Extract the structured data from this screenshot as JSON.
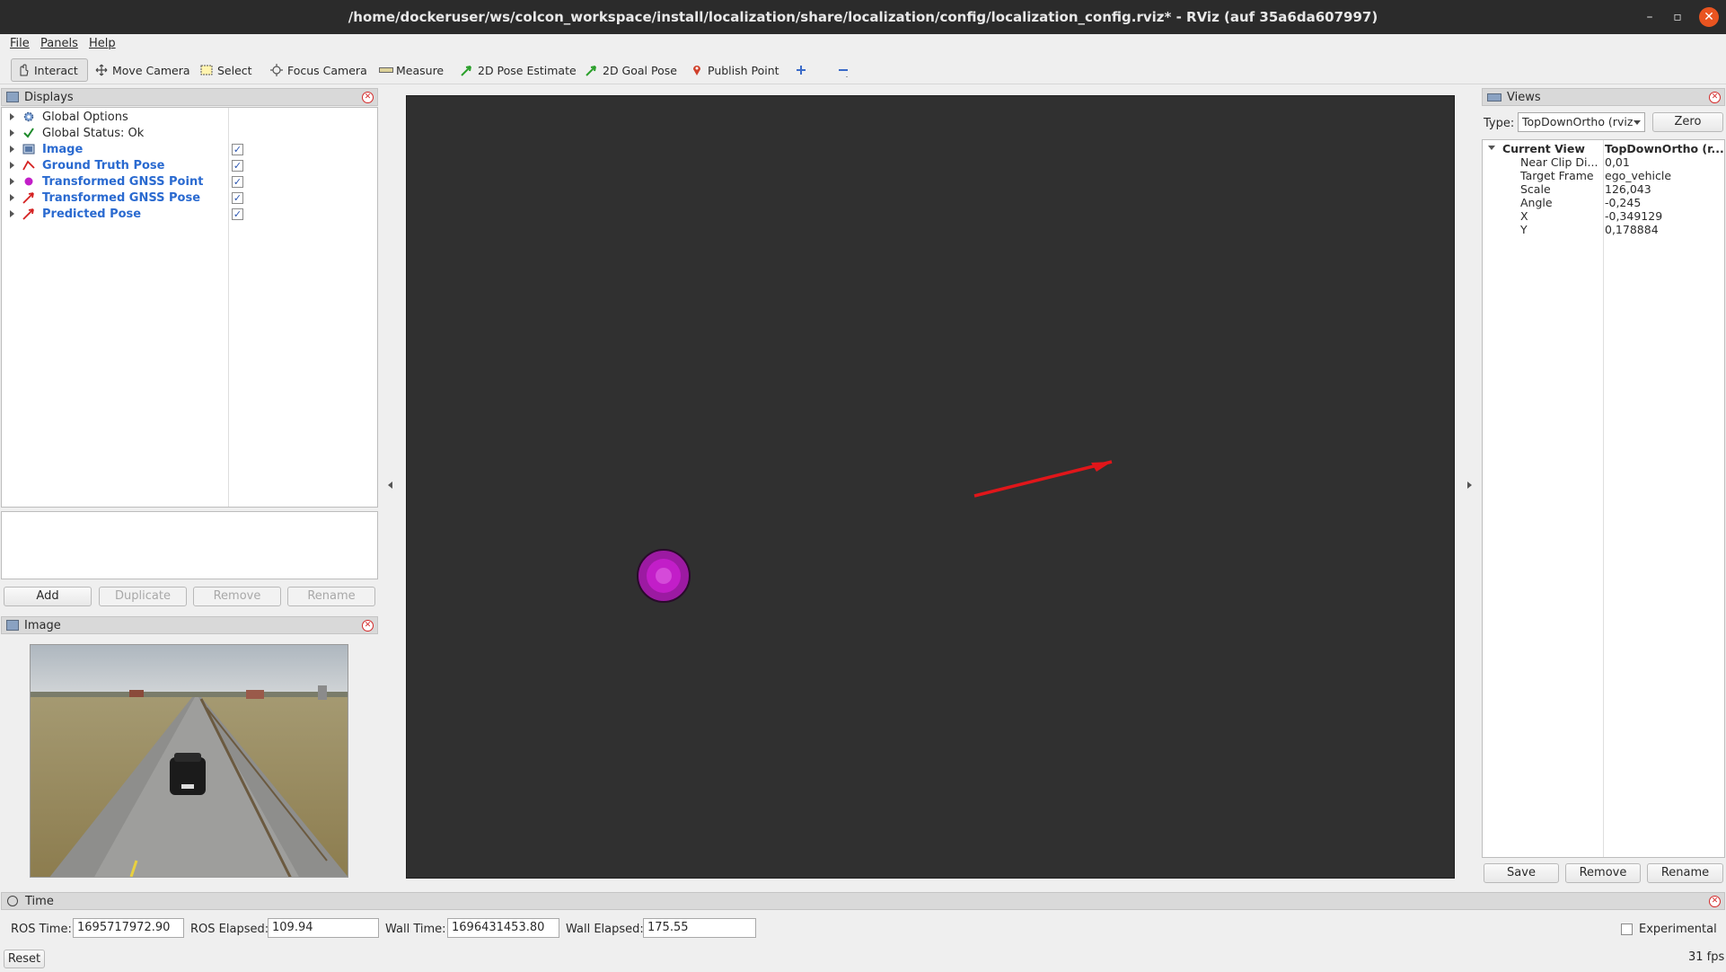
{
  "window": {
    "title": "/home/dockeruser/ws/colcon_workspace/install/localization/share/localization/config/localization_config.rviz* - RViz (auf 35a6da607997)"
  },
  "menu": [
    "File",
    "Panels",
    "Help"
  ],
  "toolbar": {
    "interact": "Interact",
    "move_camera": "Move Camera",
    "select": "Select",
    "focus_camera": "Focus Camera",
    "measure": "Measure",
    "pose_estimate": "2D Pose Estimate",
    "goal_pose": "2D Goal Pose",
    "publish_point": "Publish Point"
  },
  "displays": {
    "title": "Displays",
    "items": [
      {
        "label": "Global Options"
      },
      {
        "label": "Global Status: Ok"
      },
      {
        "label": "Image",
        "checked": true
      },
      {
        "label": "Ground Truth Pose",
        "checked": true
      },
      {
        "label": "Transformed GNSS Point",
        "checked": true
      },
      {
        "label": "Transformed GNSS Pose",
        "checked": true
      },
      {
        "label": "Predicted Pose",
        "checked": true
      }
    ],
    "buttons": {
      "add": "Add",
      "duplicate": "Duplicate",
      "remove": "Remove",
      "rename": "Rename"
    },
    "check_mark": "✓"
  },
  "image_panel": {
    "title": "Image"
  },
  "views": {
    "title": "Views",
    "type_label": "Type:",
    "type_value": "TopDownOrtho (rviz",
    "zero": "Zero",
    "current_view": {
      "label": "Current View",
      "value": "TopDownOrtho (r..."
    },
    "props": [
      {
        "key": "Near Clip Di...",
        "value": "0,01"
      },
      {
        "key": "Target Frame",
        "value": "ego_vehicle"
      },
      {
        "key": "Scale",
        "value": "126,043"
      },
      {
        "key": "Angle",
        "value": "-0,245"
      },
      {
        "key": "X",
        "value": "-0,349129"
      },
      {
        "key": "Y",
        "value": "0,178884"
      }
    ],
    "buttons": {
      "save": "Save",
      "remove": "Remove",
      "rename": "Rename"
    }
  },
  "time": {
    "title": "Time",
    "ros_time_label": "ROS Time:",
    "ros_time": "1695717972.90",
    "ros_elapsed_label": "ROS Elapsed:",
    "ros_elapsed": "109.94",
    "wall_time_label": "Wall Time:",
    "wall_time": "1696431453.80",
    "wall_elapsed_label": "Wall Elapsed:",
    "wall_elapsed": "175.55",
    "experimental": "Experimental",
    "reset": "Reset",
    "fps": "31 fps"
  },
  "colors": {
    "viewport_bg": "#303030",
    "arrow": "#e0161a",
    "gnss_point": "#c21ec8",
    "display_label": "#2a6ad0"
  }
}
